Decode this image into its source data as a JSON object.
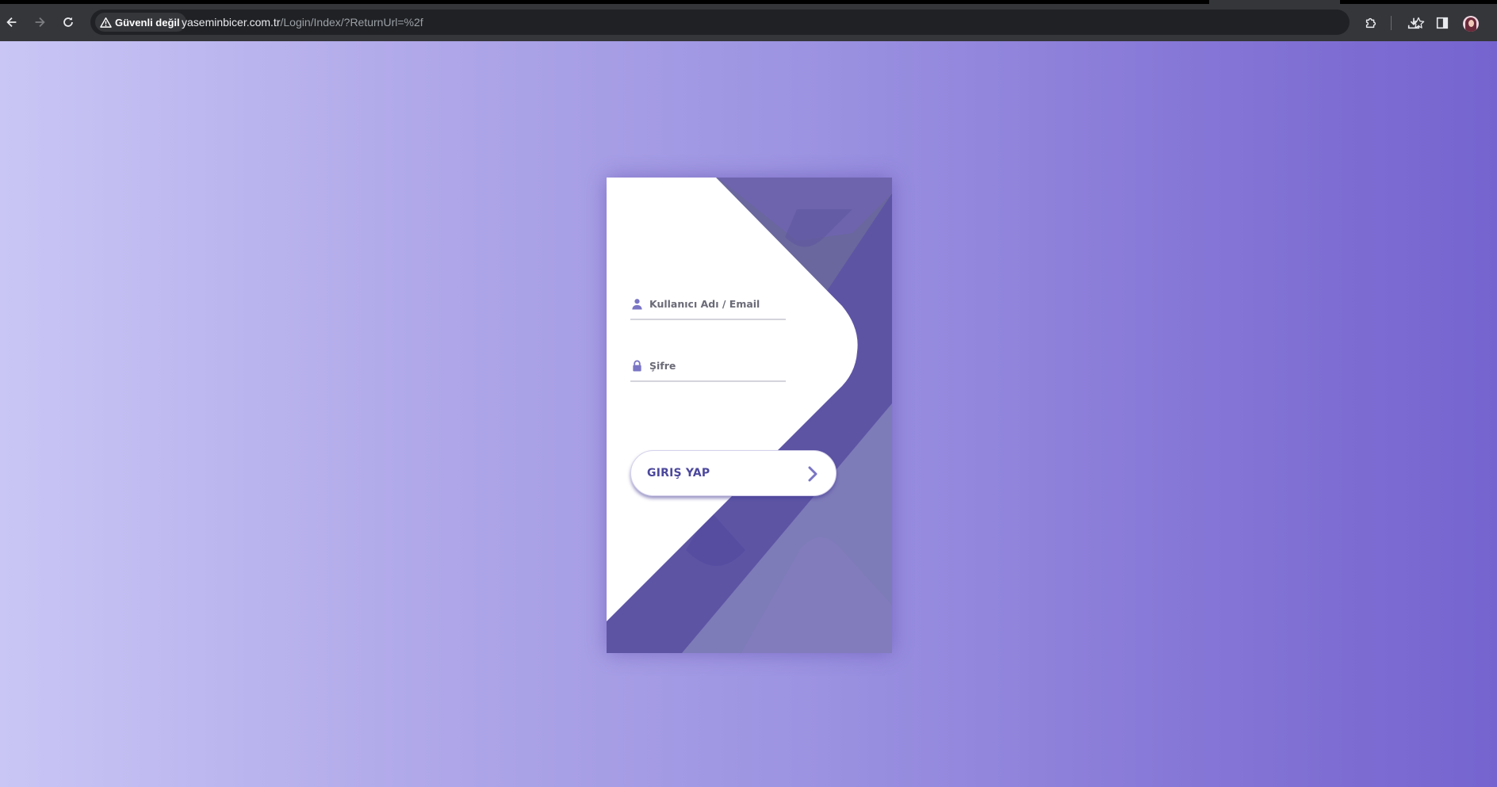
{
  "browser": {
    "security_label": "Güvenli değil",
    "url_domain": "yaseminbicer.com.tr",
    "url_path": "/Login/Index/?ReturnUrl=%2f",
    "icons": [
      "back-arrow-icon",
      "forward-arrow-icon",
      "reload-icon",
      "warning-triangle-icon",
      "bookmark-star-icon",
      "extensions-puzzle-icon",
      "download-icon",
      "side-panel-icon",
      "profile-avatar"
    ]
  },
  "login": {
    "username_placeholder": "Kullanıcı Adı / Email",
    "password_placeholder": "Şifre",
    "submit_label": "GIRIŞ YAP",
    "colors": {
      "accent": "#4c489d",
      "dark_purple": "#5d54a4",
      "mid_purple": "#6a679e",
      "light_purple": "#7e7bb9"
    }
  }
}
